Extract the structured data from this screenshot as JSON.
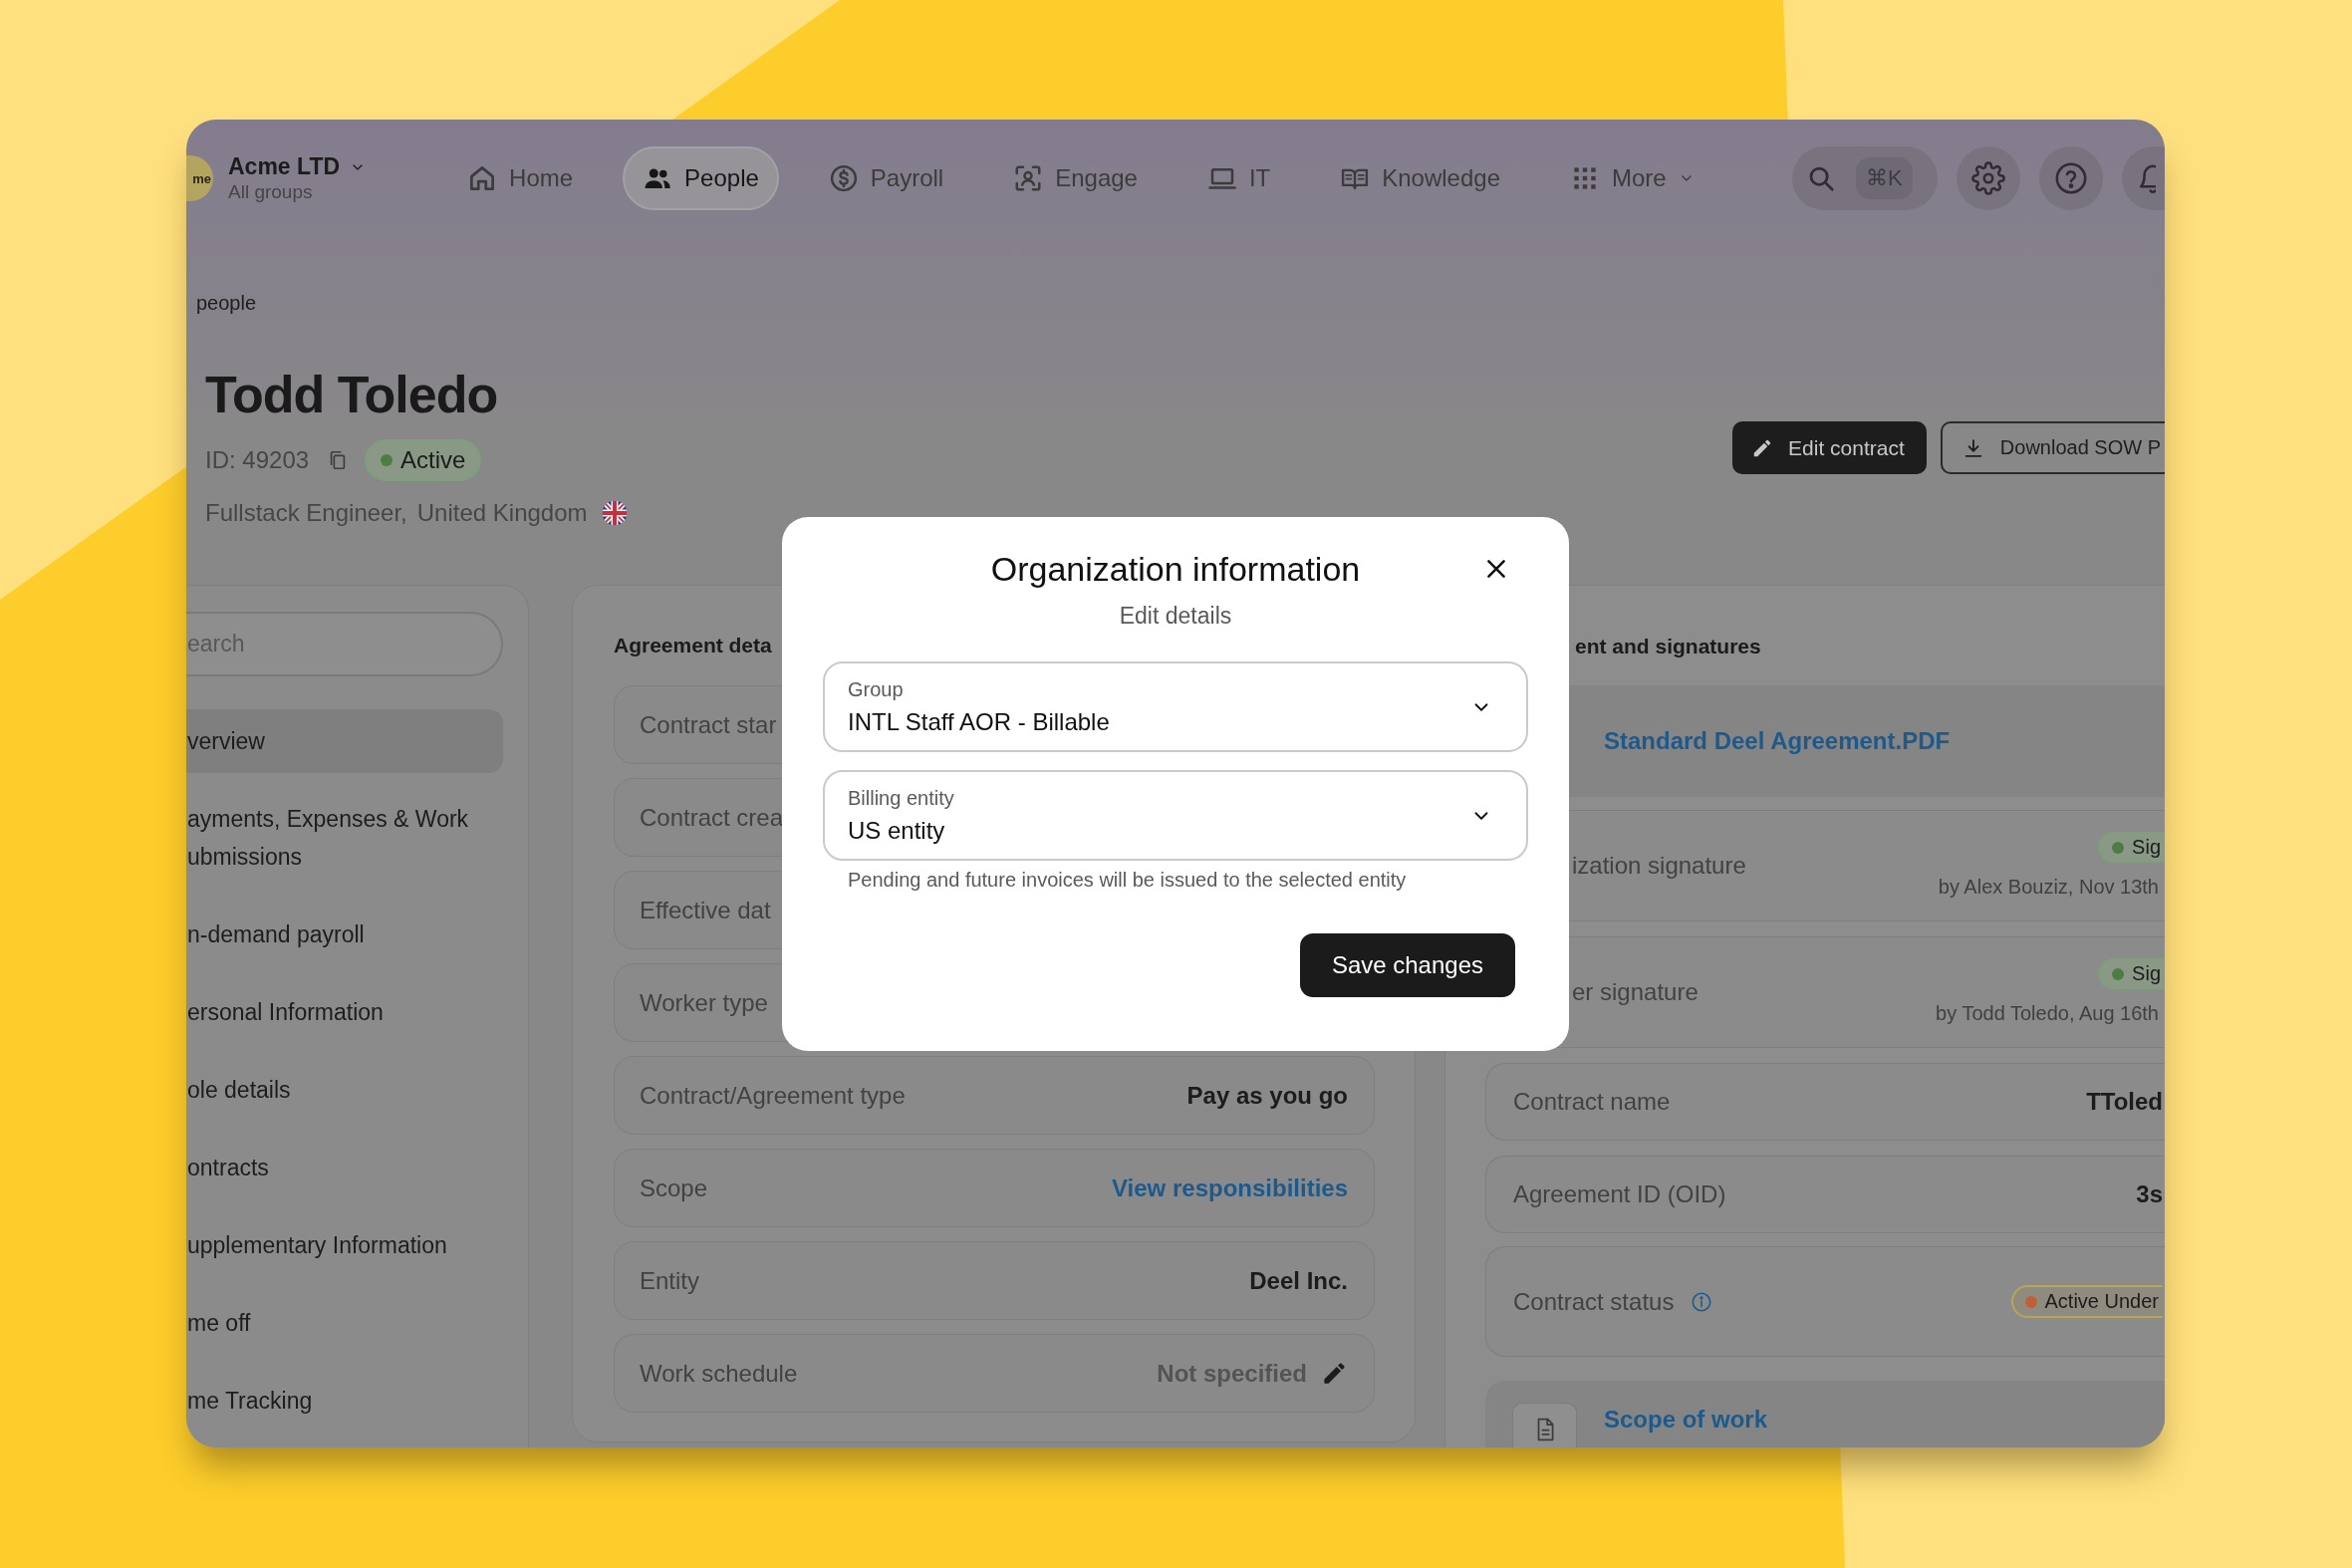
{
  "app": {
    "logo_text": "me",
    "org": {
      "name": "Acme LTD",
      "subtitle": "All groups"
    },
    "nav": [
      {
        "label": "Home",
        "selected": false,
        "caret": false
      },
      {
        "label": "People",
        "selected": true,
        "caret": false
      },
      {
        "label": "Payroll",
        "selected": false,
        "caret": false
      },
      {
        "label": "Engage",
        "selected": false,
        "caret": false
      },
      {
        "label": "IT",
        "selected": false,
        "caret": false
      },
      {
        "label": "Knowledge",
        "selected": false,
        "caret": false
      },
      {
        "label": "More",
        "selected": false,
        "caret": true
      }
    ],
    "search_shortcut": "⌘K"
  },
  "breadcrumb": "people",
  "profile": {
    "name": "Todd Toledo",
    "id": "ID: 49203",
    "status": {
      "label": "Active",
      "color": "#4d7c45"
    },
    "role": "Fullstack Engineer,",
    "country": "United Kingdom"
  },
  "actions": [
    {
      "label": "Edit contract",
      "kind": "primary"
    },
    {
      "label": "Download SOW P",
      "kind": "outline"
    }
  ],
  "sidebar": {
    "search_placeholder": "earch",
    "items": [
      {
        "lines": [
          "verview"
        ],
        "selected": true
      },
      {
        "lines": [
          "ayments, Expenses & Work",
          "ubmissions"
        ],
        "selected": false
      },
      {
        "lines": [
          "n-demand payroll"
        ],
        "selected": false
      },
      {
        "lines": [
          "ersonal Information"
        ],
        "selected": false
      },
      {
        "lines": [
          "ole details"
        ],
        "selected": false
      },
      {
        "lines": [
          "ontracts"
        ],
        "selected": false
      },
      {
        "lines": [
          "upplementary Information"
        ],
        "selected": false
      },
      {
        "lines": [
          "me off"
        ],
        "selected": false
      },
      {
        "lines": [
          "me Tracking"
        ],
        "selected": false
      }
    ]
  },
  "agreement_card": {
    "title": "Agreement deta",
    "rows": [
      {
        "label": "Contract star",
        "editable": false
      },
      {
        "label": "Contract crea",
        "editable": false
      },
      {
        "label": "Effective dat",
        "editable": false
      },
      {
        "label": "Worker type",
        "editable": false
      },
      {
        "label": "Contract/Agreement type",
        "kind": "text",
        "value": "Pay as you go",
        "editable": false
      },
      {
        "label": "Scope",
        "kind": "link",
        "value": "View responsibilities",
        "editable": false
      },
      {
        "label": "Entity",
        "kind": "text",
        "value": "Deel Inc.",
        "editable": false
      },
      {
        "label": "Work schedule",
        "kind": "muted",
        "value": "Not specified",
        "editable": true
      }
    ]
  },
  "signatures_card": {
    "title": "ent and signatures",
    "document": "Standard Deel Agreement.PDF",
    "signatures": [
      {
        "label": "ization signature",
        "status": "Sig",
        "color": "#4d7c45",
        "by": "by Alex Bouziz, Nov 13th"
      },
      {
        "label": "er signature",
        "status": "Sig",
        "color": "#4d7c45",
        "by": "by Todd Toledo, Aug 16th"
      }
    ],
    "rows": [
      {
        "label": "Contract name",
        "kind": "text",
        "value": "TToled",
        "info": false
      },
      {
        "label": "Agreement ID (OID)",
        "kind": "text",
        "value": "3s",
        "info": false
      },
      {
        "label": "Contract status",
        "kind": "badge",
        "value": "Active Under",
        "color": "#c25f3b",
        "info": true
      }
    ],
    "scope_link": "Scope of work"
  },
  "modal": {
    "title": "Organization information",
    "subtitle": "Edit details",
    "fields": [
      {
        "label": "Group",
        "value": "INTL Staff AOR - Billable"
      },
      {
        "label": "Billing entity",
        "value": "US entity"
      }
    ],
    "helper": "Pending and future invoices will be issued to the selected entity",
    "submit": "Save changes"
  }
}
